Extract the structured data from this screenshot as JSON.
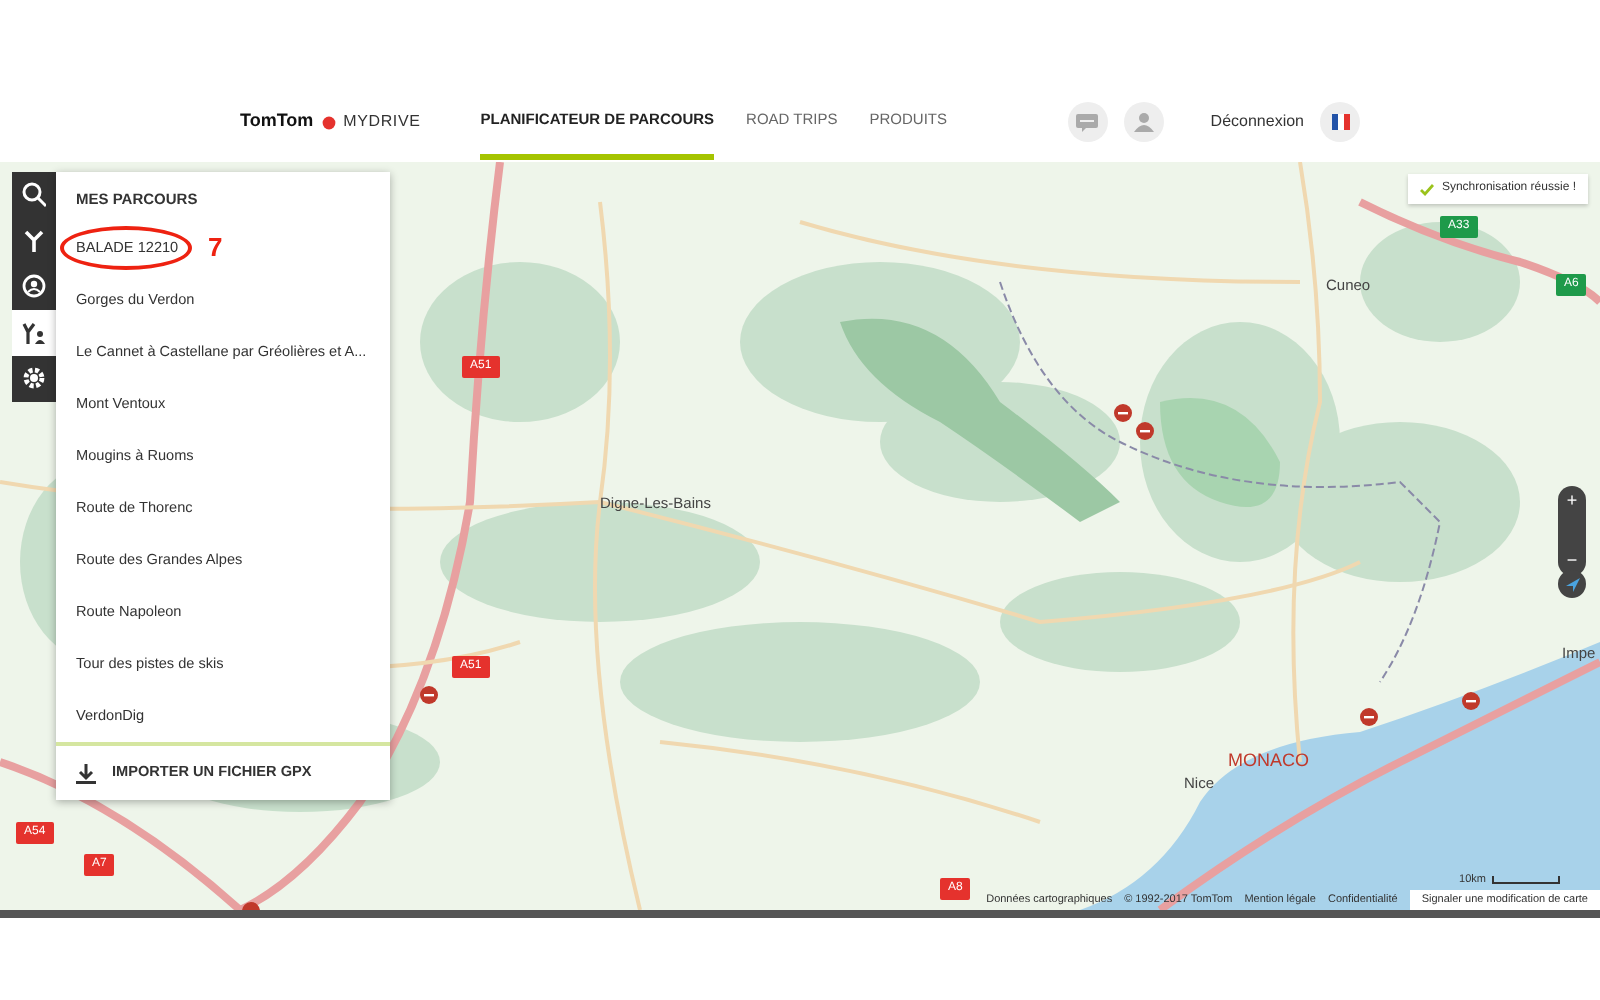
{
  "header": {
    "brand": "TomTom",
    "product": "MYDRIVE",
    "nav": [
      {
        "label": "PLANIFICATEUR DE PARCOURS",
        "selected": true
      },
      {
        "label": "ROAD TRIPS",
        "selected": false
      },
      {
        "label": "PRODUITS",
        "selected": false
      }
    ],
    "logout": "Déconnexion"
  },
  "sidebar": {
    "tools": [
      {
        "kind": "search",
        "selected": false
      },
      {
        "kind": "route",
        "selected": false
      },
      {
        "kind": "places",
        "selected": false
      },
      {
        "kind": "my-routes",
        "selected": true
      },
      {
        "kind": "settings",
        "selected": false
      }
    ]
  },
  "routes_panel": {
    "title": "MES PARCOURS",
    "annotation": "7",
    "routes": [
      {
        "name": "BALADE 12210",
        "circled": true
      },
      {
        "name": "Gorges du Verdon",
        "circled": false
      },
      {
        "name": "Le Cannet à Castellane par Gréolières et A...",
        "circled": false
      },
      {
        "name": "Mont Ventoux",
        "circled": false
      },
      {
        "name": "Mougins à Ruoms",
        "circled": false
      },
      {
        "name": "Route de Thorenc",
        "circled": false
      },
      {
        "name": "Route des Grandes Alpes",
        "circled": false
      },
      {
        "name": "Route Napoleon",
        "circled": false
      },
      {
        "name": "Tour des pistes de skis",
        "circled": false
      },
      {
        "name": "VerdonDig",
        "circled": false
      }
    ],
    "import_button": "IMPORTER UN FICHIER GPX"
  },
  "map": {
    "toast": "Synchronisation réussie !",
    "places": [
      "Digne-Les-Bains",
      "Cuneo",
      "Nice",
      "MONACO",
      "Impe"
    ],
    "road_shields": [
      {
        "label": "A51",
        "color": "#e5322d"
      },
      {
        "label": "A51",
        "color": "#e5322d"
      },
      {
        "label": "A54",
        "color": "#e5322d"
      },
      {
        "label": "A7",
        "color": "#e5322d"
      },
      {
        "label": "A8",
        "color": "#e5322d"
      },
      {
        "label": "A33",
        "color": "#1e9a4a"
      },
      {
        "label": "A6",
        "color": "#1e9a4a"
      }
    ],
    "zoom_in": "+",
    "zoom_out": "−",
    "scale": "10km",
    "attribution": [
      "Données cartographiques",
      "© 1992-2017 TomTom",
      "Mention légale",
      "Confidentialité"
    ],
    "report_link": "Signaler une modification de carte"
  }
}
